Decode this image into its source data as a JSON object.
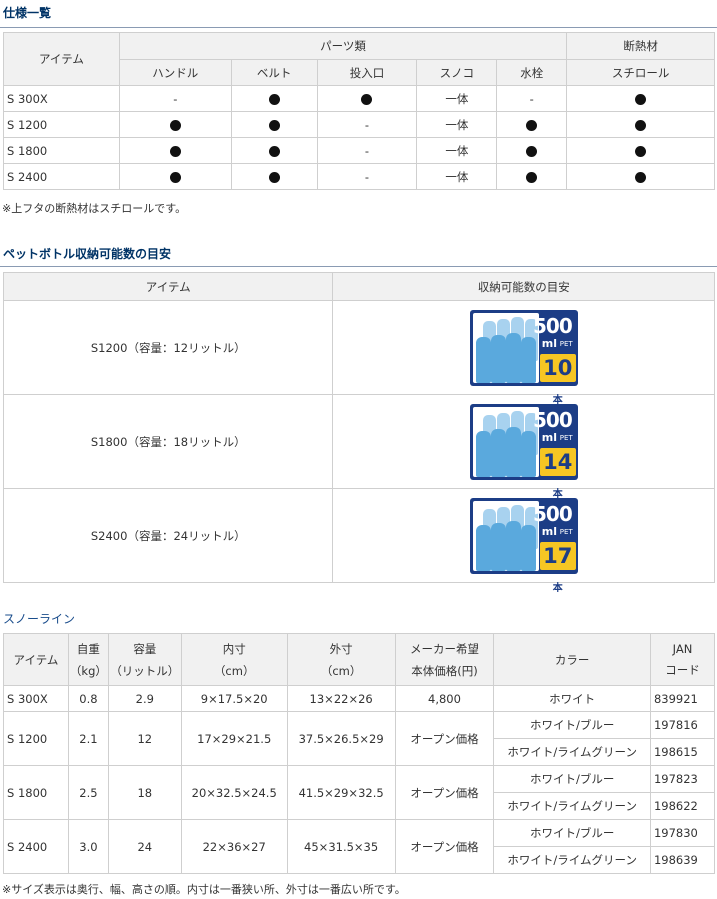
{
  "spec": {
    "title": "仕様一覧",
    "col_item": "アイテム",
    "group_parts": "パーツ類",
    "group_insulation": "断熱材",
    "cols": [
      "ハンドル",
      "ベルト",
      "投入口",
      "スノコ",
      "水栓",
      "スチロール"
    ],
    "rows": [
      {
        "item": "S 300X",
        "cells": [
          "-",
          "dot",
          "dot",
          "一体",
          "-",
          "dot"
        ]
      },
      {
        "item": "S 1200",
        "cells": [
          "dot",
          "dot",
          "-",
          "一体",
          "dot",
          "dot"
        ]
      },
      {
        "item": "S 1800",
        "cells": [
          "dot",
          "dot",
          "-",
          "一体",
          "dot",
          "dot"
        ]
      },
      {
        "item": "S 2400",
        "cells": [
          "dot",
          "dot",
          "-",
          "一体",
          "dot",
          "dot"
        ]
      }
    ],
    "note": "※上フタの断熱材はスチロールです。"
  },
  "bottle": {
    "title": "ペットボトル収納可能数の目安",
    "col_item": "アイテム",
    "col_capacity": "収納可能数の目安",
    "badge_volume": "500",
    "badge_unit": "ml",
    "badge_type": "PET",
    "badge_suffix": "本",
    "rows": [
      {
        "item": "S1200（容量：12リットル）",
        "count": "10"
      },
      {
        "item": "S1800（容量：18リットル）",
        "count": "14"
      },
      {
        "item": "S2400（容量：24リットル）",
        "count": "17"
      }
    ]
  },
  "snowline": {
    "title": "スノーライン",
    "headers": {
      "item": "アイテム",
      "weight_1": "自重",
      "weight_2": "（kg）",
      "cap_1": "容量",
      "cap_2": "（リットル）",
      "inner_1": "内寸",
      "inner_2": "（cm）",
      "outer_1": "外寸",
      "outer_2": "（cm）",
      "price_1": "メーカー希望",
      "price_2": "本体価格(円)",
      "color": "カラー",
      "jan_1": "JAN",
      "jan_2": "コード"
    },
    "rows": [
      {
        "item": "S 300X",
        "weight": "0.8",
        "capacity": "2.9",
        "inner": "9×17.5×20",
        "outer": "13×22×26",
        "price": "4,800",
        "variants": [
          {
            "color": "ホワイト",
            "jan": "839921"
          }
        ]
      },
      {
        "item": "S 1200",
        "weight": "2.1",
        "capacity": "12",
        "inner": "17×29×21.5",
        "outer": "37.5×26.5×29",
        "price": "オープン価格",
        "variants": [
          {
            "color": "ホワイト/ブルー",
            "jan": "197816"
          },
          {
            "color": "ホワイト/ライムグリーン",
            "jan": "198615"
          }
        ]
      },
      {
        "item": "S 1800",
        "weight": "2.5",
        "capacity": "18",
        "inner": "20×32.5×24.5",
        "outer": "41.5×29×32.5",
        "price": "オープン価格",
        "variants": [
          {
            "color": "ホワイト/ブルー",
            "jan": "197823"
          },
          {
            "color": "ホワイト/ライムグリーン",
            "jan": "198622"
          }
        ]
      },
      {
        "item": "S 2400",
        "weight": "3.0",
        "capacity": "24",
        "inner": "22×36×27",
        "outer": "45×31.5×35",
        "price": "オープン価格",
        "variants": [
          {
            "color": "ホワイト/ブルー",
            "jan": "197830"
          },
          {
            "color": "ホワイト/ライムグリーン",
            "jan": "198639"
          }
        ]
      }
    ],
    "note": "※サイズ表示は奥行、幅、高さの順。内寸は一番狭い所、外寸は一番広い所です。"
  }
}
